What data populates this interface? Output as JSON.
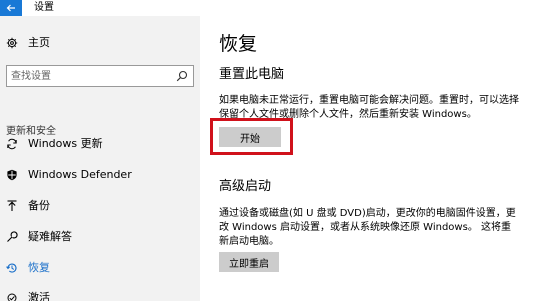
{
  "window": {
    "title": "设置"
  },
  "sidebar": {
    "home_label": "主页",
    "search_placeholder": "查找设置",
    "section_label": "更新和安全",
    "items": [
      {
        "label": "Windows 更新",
        "icon": "sync-icon"
      },
      {
        "label": "Windows Defender",
        "icon": "shield-icon"
      },
      {
        "label": "备份",
        "icon": "upload-icon"
      },
      {
        "label": "疑难解答",
        "icon": "wrench-icon"
      },
      {
        "label": "恢复",
        "icon": "history-icon"
      },
      {
        "label": "激活",
        "icon": "activation-icon"
      }
    ],
    "active_index": 4
  },
  "main": {
    "title": "恢复",
    "reset": {
      "heading": "重置此电脑",
      "description": "如果电脑未正常运行，重置电脑可能会解决问题。重置时，可以选择保留个人文件或删除个人文件，然后重新安装 Windows。",
      "button_label": "开始"
    },
    "advanced": {
      "heading": "高级启动",
      "description": "通过设备或磁盘(如 U 盘或 DVD)启动，更改你的电脑固件设置，更改 Windows 启动设置，或者从系统映像还原 Windows。 这将重新启动电脑。",
      "button_label": "立即重启"
    }
  },
  "colors": {
    "accent": "#1979d6",
    "highlight_box": "#d0111b",
    "sidebar_bg": "#f2f2f2",
    "button_bg": "#cccccc"
  }
}
